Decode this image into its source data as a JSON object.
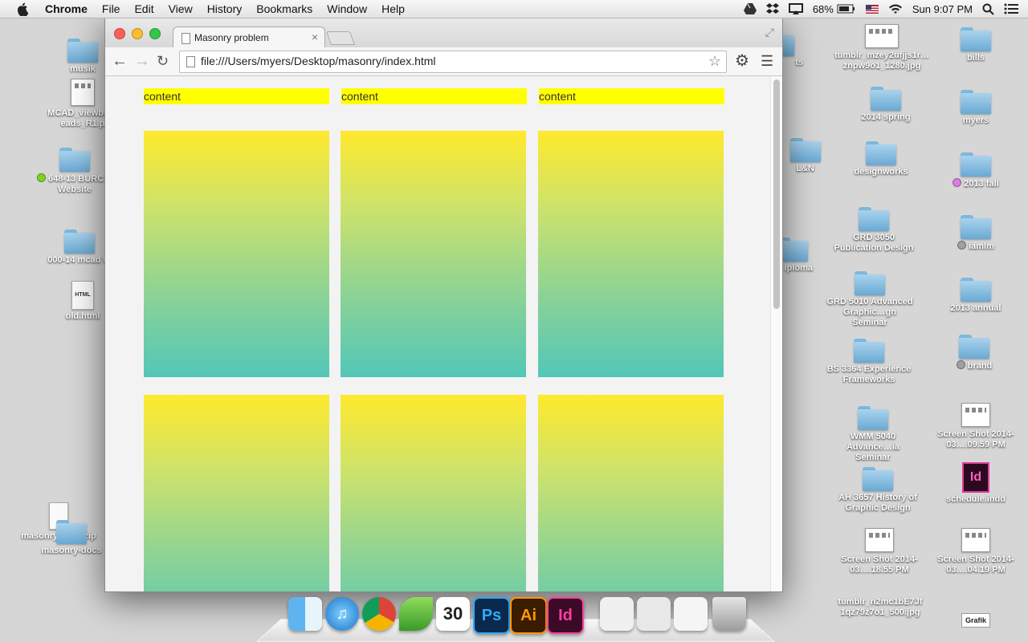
{
  "menubar": {
    "app_name": "Chrome",
    "menus": [
      "File",
      "Edit",
      "View",
      "History",
      "Bookmarks",
      "Window",
      "Help"
    ],
    "battery": "68%",
    "clock": "Sun 9:07 PM"
  },
  "browser": {
    "tab_title": "Masonry problem",
    "url": "file:///Users/myers/Desktop/masonry/index.html"
  },
  "page": {
    "labels": [
      "content",
      "content",
      "content"
    ],
    "tile_gradient": [
      "#ffe92c",
      "#52c7b8"
    ],
    "label_color": "#ffff00"
  },
  "desktop_left": [
    {
      "label": "musik",
      "type": "folder"
    },
    {
      "label": "MCAD_viewbo…eads_R1.p",
      "type": "image"
    },
    {
      "label": "648-13 BURC… Website",
      "type": "folder",
      "tag_color": "#7ed321"
    },
    {
      "label": "000-14 mcad tu",
      "type": "folder"
    },
    {
      "label": "old.html",
      "type": "html"
    },
    {
      "label": "masonry-docs.zip",
      "type": "zip"
    },
    {
      "label": "masonry-docs",
      "type": "folder"
    }
  ],
  "desktop_col1": [
    {
      "label": "tumblr_mzey2ufjjs1r…znpw9o1_1280.jpg",
      "type": "image"
    },
    {
      "label": "2014 spring",
      "type": "folder"
    },
    {
      "label": "designworks",
      "type": "folder"
    },
    {
      "label": "GRD 3050 Publication Design",
      "type": "folder"
    },
    {
      "label": "GRD 5010 Advanced Graphic…gn Seminar",
      "type": "folder"
    },
    {
      "label": "BS 3364 Experience Frameworks",
      "type": "folder"
    },
    {
      "label": "WMM 5040 Advance…ia Seminar",
      "type": "folder"
    },
    {
      "label": "AH 3657 History of Graphic Design",
      "type": "folder"
    },
    {
      "label": "Screen Shot 2014-03….18.55 PM",
      "type": "image"
    },
    {
      "label": "tumblr_n2mc1bE7Jf 1qz79z7o1_500.jpg",
      "type": "image"
    }
  ],
  "desktop_col2": [
    {
      "label": "bills",
      "type": "folder"
    },
    {
      "label": "myers",
      "type": "folder"
    },
    {
      "label": "2013 fall",
      "type": "folder",
      "tag_color": "#d77ee0"
    },
    {
      "label": "iamlm",
      "type": "folder",
      "tag_color": "#a0a0a0"
    },
    {
      "label": "2013 annual",
      "type": "folder"
    },
    {
      "label": "brand",
      "type": "folder",
      "tag_color": "#a0a0a0"
    },
    {
      "label": "Screen Shot 2014-03….09.59 PM",
      "type": "image"
    },
    {
      "label": "schedule.indd",
      "type": "indd"
    },
    {
      "label": "Screen Shot 2014-03….04.19 PM",
      "type": "image"
    },
    {
      "label": "Grafik",
      "type": "image"
    }
  ],
  "desktop_partial": [
    {
      "label": "ts"
    },
    {
      "label": "L&N"
    },
    {
      "label": "iploma"
    }
  ],
  "dock": {
    "apps": [
      {
        "name": "finder-icon"
      },
      {
        "name": "itunes-icon"
      },
      {
        "name": "chrome-icon"
      },
      {
        "name": "leaf-icon"
      },
      {
        "name": "calendar-icon",
        "label": "30"
      },
      {
        "name": "photoshop-icon",
        "label": "Ps"
      },
      {
        "name": "illustrator-icon",
        "label": "Ai"
      },
      {
        "name": "indesign-icon",
        "label": "Id"
      }
    ]
  }
}
